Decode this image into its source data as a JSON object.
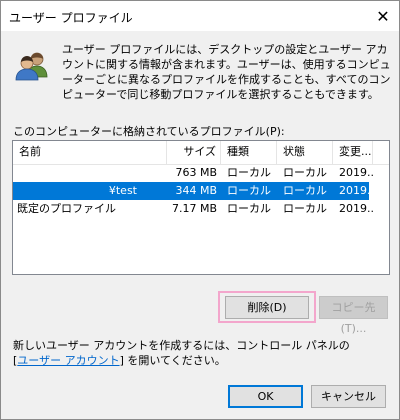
{
  "window": {
    "title": "ユーザー プロファイル",
    "close_glyph": "✕"
  },
  "description": "ユーザー プロファイルには、デスクトップの設定とユーザー アカウントに関する情報が含まれます。ユーザーは、使用するコンピューターごとに異なるプロファイルを作成することも、すべてのコンピューターで同じ移動プロファイルを選択することもできます。",
  "list": {
    "label": "このコンピューターに格納されているプロファイル(P):",
    "columns": [
      "名前",
      "サイズ",
      "種類",
      "状態",
      "変更..."
    ],
    "rows": [
      {
        "name": "",
        "size": "763 MB",
        "type": "ローカル",
        "status": "ローカル",
        "modified": "2019..."
      },
      {
        "name": "¥test",
        "size": "344 MB",
        "type": "ローカル",
        "status": "ローカル",
        "modified": "2019..."
      },
      {
        "name": "既定のプロファイル",
        "size": "7.17 MB",
        "type": "ローカル",
        "status": "ローカル",
        "modified": "2019..."
      }
    ],
    "selected_row": 1
  },
  "buttons": {
    "delete": "削除(D)",
    "copy": "コピー先(T)...",
    "ok": "OK",
    "cancel": "キャンセル"
  },
  "footer": {
    "line1": "新しいユーザー アカウントを作成するには、コントロール パネルの",
    "link_open": "[",
    "link": "ユーザー アカウント",
    "link_close": "]",
    "line2_rest": " を開いてください。"
  },
  "colors": {
    "selection": "#0078d7",
    "link": "#0066cc",
    "highlight_frame": "#f3a6cc"
  },
  "icons": {
    "users": "users-icon",
    "close": "close-icon"
  }
}
